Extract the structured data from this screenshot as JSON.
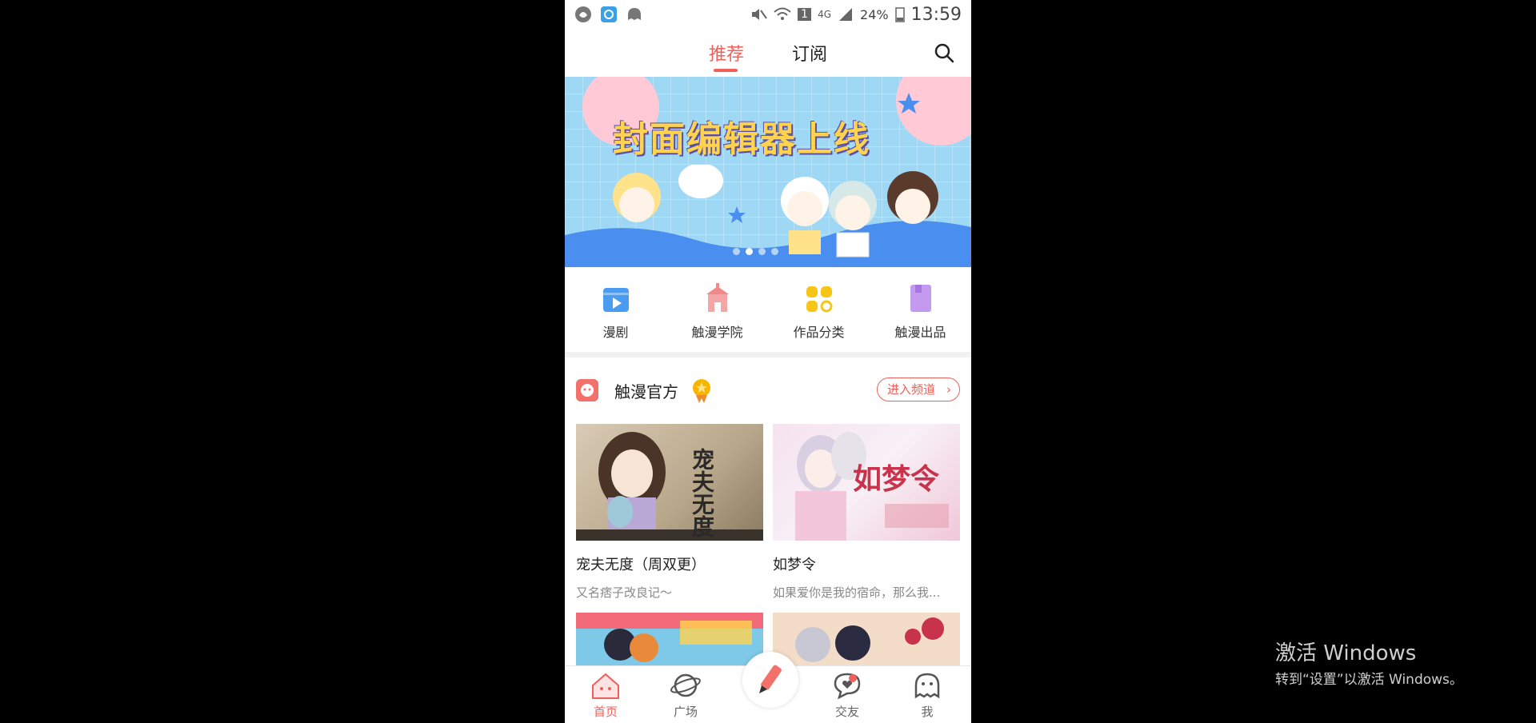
{
  "status_bar": {
    "battery": "24%",
    "network": "4G",
    "sim": "1",
    "time": "13:59"
  },
  "top_tabs": [
    {
      "label": "推荐",
      "active": true
    },
    {
      "label": "订阅",
      "active": false
    }
  ],
  "banner": {
    "title": "封面编辑器上线",
    "page_count": 4,
    "active_page": 2
  },
  "quick_menu": [
    {
      "label": "漫剧",
      "icon": "video-icon",
      "color": "#4a9cf0"
    },
    {
      "label": "触漫学院",
      "icon": "academy-icon",
      "color": "#f08a8a"
    },
    {
      "label": "作品分类",
      "icon": "category-icon",
      "color": "#f5c518"
    },
    {
      "label": "触漫出品",
      "icon": "book-icon",
      "color": "#c49af0"
    }
  ],
  "section": {
    "title": "触漫官方",
    "enter_label": "进入频道"
  },
  "cards": [
    {
      "title": "宠夫无度（周双更）",
      "subtitle": "又名痞子改良记～",
      "cover_text": "宠夫无度"
    },
    {
      "title": "如梦令",
      "subtitle": "如果爱你是我的宿命，那么我...",
      "cover_text": "如梦令"
    }
  ],
  "bottom_nav": [
    {
      "label": "首页",
      "icon": "home-icon",
      "active": true
    },
    {
      "label": "广场",
      "icon": "planet-icon",
      "active": false
    },
    {
      "label": "交友",
      "icon": "chat-heart-icon",
      "active": false
    },
    {
      "label": "我",
      "icon": "profile-ghost-icon",
      "active": false
    }
  ],
  "watermark": {
    "title": "激活 Windows",
    "subtitle": "转到“设置”以激活 Windows。"
  },
  "colors": {
    "accent": "#f0605a",
    "banner_bg": "#9fd8f5"
  }
}
